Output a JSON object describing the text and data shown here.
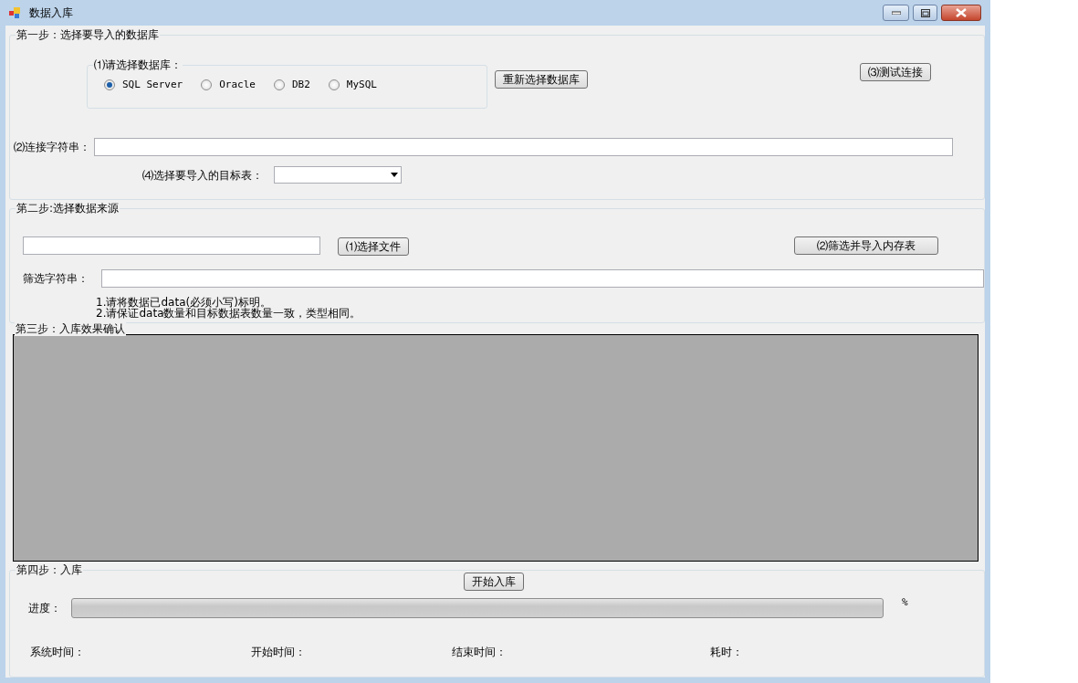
{
  "window": {
    "title": "数据入库"
  },
  "step1": {
    "legend": "第一步：选择要导入的数据库",
    "db_group": {
      "legend": "⑴请选择数据库：",
      "options": [
        {
          "label": "SQL Server",
          "selected": true
        },
        {
          "label": "Oracle",
          "selected": false
        },
        {
          "label": "DB2",
          "selected": false
        },
        {
          "label": "MySQL",
          "selected": false
        }
      ]
    },
    "reselect_button": "重新选择数据库",
    "test_button": "⑶测试连接",
    "connection_label": "⑵连接字符串：",
    "target_label": "⑷选择要导入的目标表："
  },
  "step2": {
    "legend": "第二步:选择数据来源",
    "choose_file_button": "⑴选择文件",
    "filter_import_button": "⑵筛选并导入内存表",
    "filter_label": "筛选字符串：",
    "notes": [
      "1.请将数据已data(必须小写)标明。",
      "2.请保证data数量和目标数据表数量一致，类型相同。"
    ]
  },
  "step3": {
    "legend": "第三步：入库效果确认"
  },
  "step4": {
    "legend": "第四步：入库",
    "start_button": "开始入库",
    "progress_label": "进度：",
    "progress": {
      "level": 0
    },
    "percent_label": "%",
    "time_labels": [
      "系统时间：",
      "开始时间：",
      "结束时间：",
      "耗时："
    ]
  }
}
